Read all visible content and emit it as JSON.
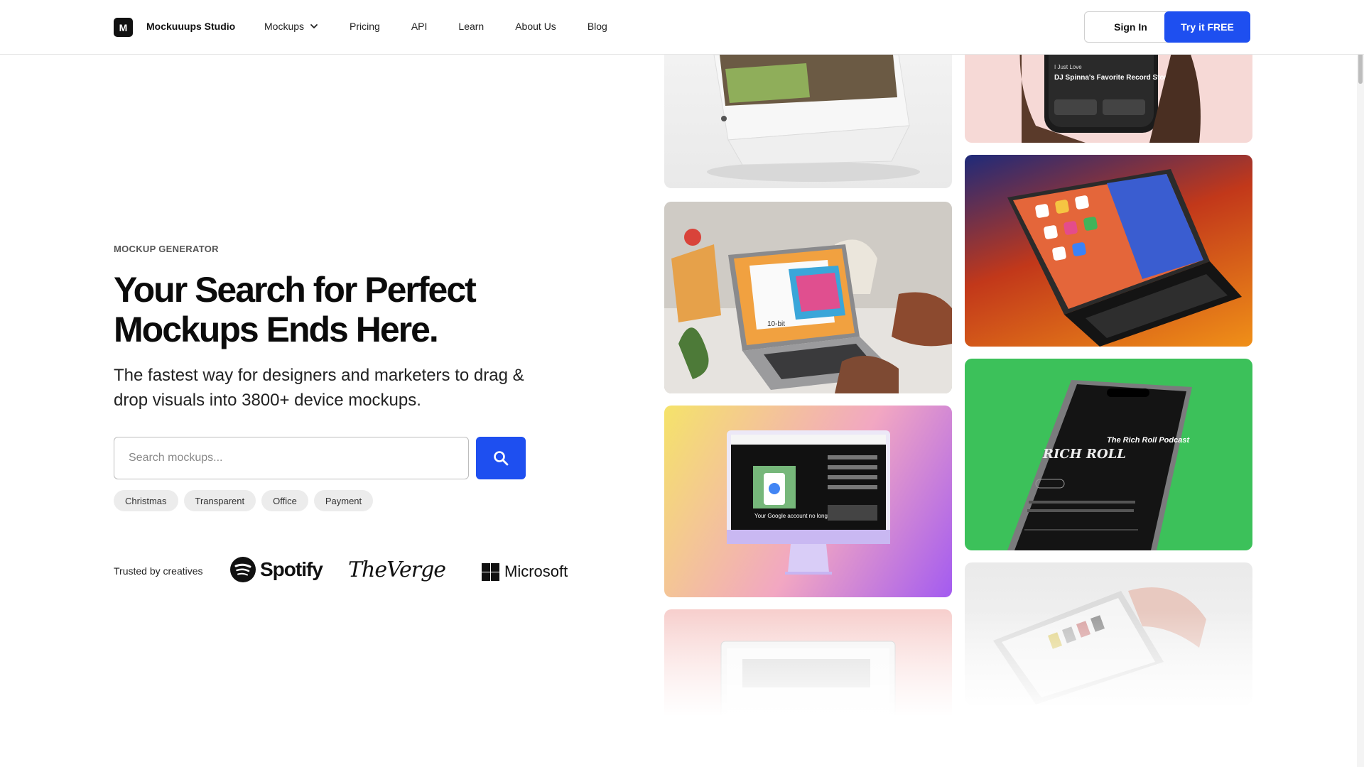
{
  "nav": {
    "logo_letter": "M",
    "brand": "Mockuuups Studio",
    "links": [
      "Mockups",
      "Pricing",
      "API",
      "Learn",
      "About Us",
      "Blog"
    ],
    "sign_in": "Sign In",
    "try_free": "Try it FREE"
  },
  "hero": {
    "eyebrow": "MOCKUP GENERATOR",
    "headline_line1": "Your Search for Perfect",
    "headline_line2": "Mockups Ends Here.",
    "subline": "The fastest way for designers and marketers to drag & drop visuals into 3800+ device mockups.",
    "search_placeholder": "Search mockups...",
    "tags": [
      "Christmas",
      "Transparent",
      "Office",
      "Payment"
    ],
    "trusted_label": "Trusted by creatives",
    "brands": [
      "Spotify",
      "TheVerge",
      "Microsoft"
    ]
  },
  "gallery": {
    "phone_screen_title": "DJ Spinna's Favorite Record Stores",
    "phone_screen_kicker": "I Just Love",
    "laptop_screen_label": "10-bit",
    "imac_screen_text": "Your Google account no longer needs a",
    "podcast_title": "The Rich Roll Podcast",
    "podcast_badge": "RICH ROLL",
    "colors": {
      "card_green": "#3cc15a",
      "card_pink": "#f6d9d6",
      "card_orange": "#f08a1c",
      "accent_blue": "#1e4ff0"
    }
  }
}
